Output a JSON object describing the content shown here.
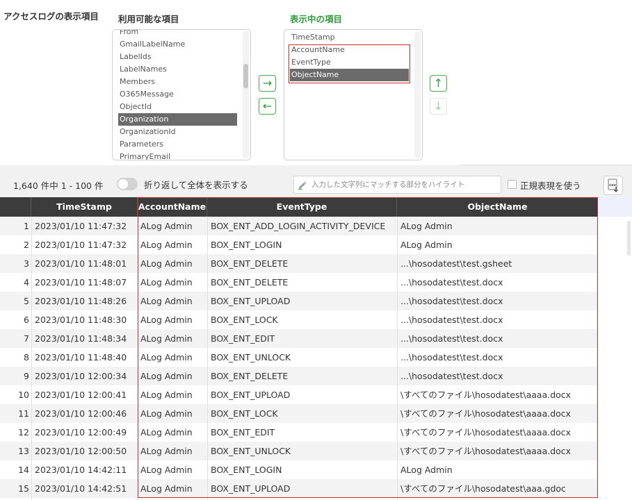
{
  "section_title": "アクセスログの表示項目",
  "available": {
    "title": "利用可能な項目",
    "items": [
      "From",
      "GmailLabelName",
      "LabelIds",
      "LabelNames",
      "Members",
      "O365Message",
      "ObjectId",
      "Organization",
      "OrganizationId",
      "Parameters",
      "PrimaryEmail"
    ],
    "selected": "Organization"
  },
  "shown": {
    "title": "表示中の項目",
    "items": [
      "TimeStamp",
      "AccountName",
      "EventType",
      "ObjectName"
    ],
    "selected": "ObjectName"
  },
  "buttons": {
    "move_right": "→",
    "move_left": "←",
    "move_up": "↑",
    "move_down": "↓",
    "csv_label": "csv"
  },
  "toolbar": {
    "count_text": "1,640 件中 1 - 100 件",
    "wrap_label": "折り返して全体を表示する",
    "highlight_placeholder": "入力した文字列にマッチする部分をハイライト",
    "regex_label": "正規表現を使う"
  },
  "colors": {
    "accent_green": "#2e9c3a",
    "highlight_red": "#cc2b2b",
    "header_dark": "#3c3c3c"
  },
  "table": {
    "columns": [
      "TimeStamp",
      "AccountName",
      "EventType",
      "ObjectName"
    ],
    "rows": [
      {
        "num": "1",
        "ts": "2023/01/10 11:47:32",
        "acc": "ALog Admin",
        "evt": "BOX_ENT_ADD_LOGIN_ACTIVITY_DEVICE",
        "obj": "ALog Admin"
      },
      {
        "num": "2",
        "ts": "2023/01/10 11:47:32",
        "acc": "ALog Admin",
        "evt": "BOX_ENT_LOGIN",
        "obj": "ALog Admin"
      },
      {
        "num": "3",
        "ts": "2023/01/10 11:48:01",
        "acc": "ALog Admin",
        "evt": "BOX_ENT_DELETE",
        "obj": "...\\hosodatest\\test.gsheet"
      },
      {
        "num": "4",
        "ts": "2023/01/10 11:48:07",
        "acc": "ALog Admin",
        "evt": "BOX_ENT_DELETE",
        "obj": "...\\hosodatest\\test.docx"
      },
      {
        "num": "5",
        "ts": "2023/01/10 11:48:26",
        "acc": "ALog Admin",
        "evt": "BOX_ENT_UPLOAD",
        "obj": "...\\hosodatest\\test.docx"
      },
      {
        "num": "6",
        "ts": "2023/01/10 11:48:30",
        "acc": "ALog Admin",
        "evt": "BOX_ENT_LOCK",
        "obj": "...\\hosodatest\\test.docx"
      },
      {
        "num": "7",
        "ts": "2023/01/10 11:48:34",
        "acc": "ALog Admin",
        "evt": "BOX_ENT_EDIT",
        "obj": "...\\hosodatest\\test.docx"
      },
      {
        "num": "8",
        "ts": "2023/01/10 11:48:40",
        "acc": "ALog Admin",
        "evt": "BOX_ENT_UNLOCK",
        "obj": "...\\hosodatest\\test.docx"
      },
      {
        "num": "9",
        "ts": "2023/01/10 12:00:34",
        "acc": "ALog Admin",
        "evt": "BOX_ENT_DELETE",
        "obj": "...\\hosodatest\\test.docx"
      },
      {
        "num": "10",
        "ts": "2023/01/10 12:00:41",
        "acc": "ALog Admin",
        "evt": "BOX_ENT_UPLOAD",
        "obj": "\\すべてのファイル\\hosodatest\\aaaa.docx"
      },
      {
        "num": "11",
        "ts": "2023/01/10 12:00:46",
        "acc": "ALog Admin",
        "evt": "BOX_ENT_LOCK",
        "obj": "\\すべてのファイル\\hosodatest\\aaaa.docx"
      },
      {
        "num": "12",
        "ts": "2023/01/10 12:00:49",
        "acc": "ALog Admin",
        "evt": "BOX_ENT_EDIT",
        "obj": "\\すべてのファイル\\hosodatest\\aaaa.docx"
      },
      {
        "num": "13",
        "ts": "2023/01/10 12:00:50",
        "acc": "ALog Admin",
        "evt": "BOX_ENT_UNLOCK",
        "obj": "\\すべてのファイル\\hosodatest\\aaaa.docx"
      },
      {
        "num": "14",
        "ts": "2023/01/10 14:42:11",
        "acc": "ALog Admin",
        "evt": "BOX_ENT_LOGIN",
        "obj": "ALog Admin"
      },
      {
        "num": "15",
        "ts": "2023/01/10 14:42:51",
        "acc": "ALog Admin",
        "evt": "BOX_ENT_UPLOAD",
        "obj": "\\すべてのファイル\\hosodatest\\aaa.gdoc"
      }
    ]
  }
}
